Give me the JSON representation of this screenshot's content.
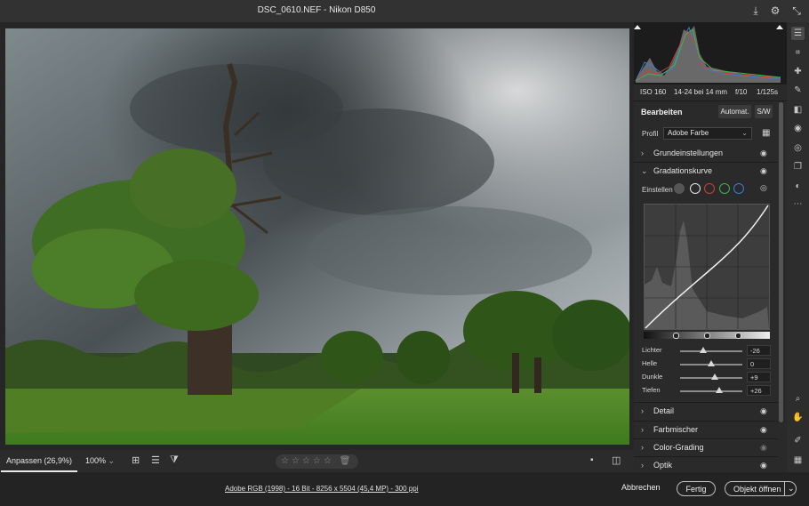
{
  "window": {
    "title": "DSC_0610.NEF - Nikon D850"
  },
  "camera_info": {
    "iso": "ISO 160",
    "lens": "14-24 bei 14 mm",
    "aperture": "f/10",
    "shutter": "1/125s"
  },
  "edit_panel": {
    "title": "Bearbeiten",
    "auto_label": "Automat.",
    "bw_label": "S/W",
    "profile_label": "Profil",
    "profile_value": "Adobe Farbe",
    "sections": {
      "basic": "Grundeinstellungen",
      "tone_curve": "Gradationskurve",
      "detail": "Detail",
      "color_mixer": "Farbmischer",
      "color_grading": "Color-Grading",
      "optics": "Optik"
    },
    "curve": {
      "adjust_label": "Einstellen",
      "sliders": [
        {
          "label": "Lichter",
          "value": "-26",
          "pos": 0.37
        },
        {
          "label": "Helle",
          "value": "0",
          "pos": 0.5
        },
        {
          "label": "Dunkle",
          "value": "+9",
          "pos": 0.55
        },
        {
          "label": "Tiefen",
          "value": "+26",
          "pos": 0.63
        }
      ]
    }
  },
  "statusbar": {
    "fit_label": "Anpassen (26,9%)",
    "zoom_label": "100%",
    "stars": "☆☆☆☆☆"
  },
  "footer": {
    "file_info": "Adobe RGB (1998) - 16 Bit - 8256 x 5504 (45,4 MP) - 300 ppi",
    "cancel_label": "Abbrechen",
    "done_label": "Fertig",
    "open_label": "Objekt öffnen"
  },
  "colors": {
    "panel_bg": "#2a2a2a",
    "accent_red": "#d23b3b",
    "accent_green": "#3cb44b",
    "accent_blue": "#3b7bd2"
  }
}
